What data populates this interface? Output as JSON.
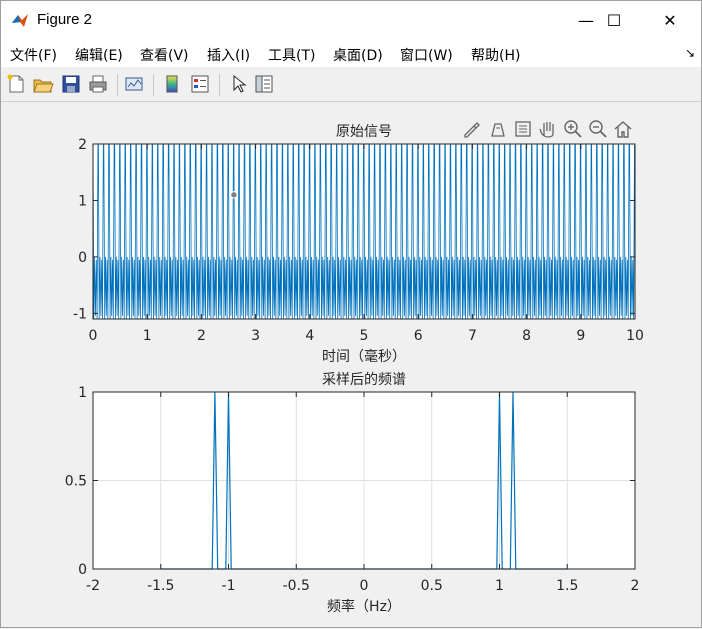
{
  "window": {
    "title": "Figure 2",
    "minimize": "—",
    "maximize": "☐",
    "close": "✕"
  },
  "menu": {
    "items": [
      "文件(F)",
      "编辑(E)",
      "查看(V)",
      "插入(I)",
      "工具(T)",
      "桌面(D)",
      "窗口(W)",
      "帮助(H)"
    ],
    "dock_arrow": "↘"
  },
  "toolbar": [
    "new-figure-icon",
    "open-file-icon",
    "save-icon",
    "print-icon",
    "link-plot-icon",
    "insert-colorbar-icon",
    "insert-legend-icon",
    "edit-plot-icon",
    "property-inspector-icon"
  ],
  "axes_toolbar": [
    "brush-icon",
    "data-tips-icon",
    "restore-view-icon",
    "pan-icon",
    "zoom-in-icon",
    "zoom-out-icon",
    "home-icon"
  ],
  "chart_data": [
    {
      "type": "line",
      "title": "原始信号",
      "xlabel": "时间（毫秒）",
      "ylabel": "",
      "xlim": [
        0,
        10
      ],
      "ylim": [
        -1.1,
        2
      ],
      "xticks": [
        "0",
        "1",
        "2",
        "3",
        "4",
        "5",
        "6",
        "7",
        "8",
        "9",
        "10"
      ],
      "yticks": [
        "2",
        "1",
        "0",
        "-1"
      ],
      "grid": false,
      "series": [
        {
          "description": "dense oscillating signal, peaks at 2, troughs near -1.1, periodic bursts",
          "cycles_per_unit": 10,
          "max": 2,
          "min": -1.1,
          "color": "#0072bd"
        }
      ],
      "marker_point": {
        "x": 2.6,
        "y": 1.1,
        "color": "#808080"
      }
    },
    {
      "type": "line",
      "title": "采样后的频谱",
      "xlabel": "频率（Hz）",
      "ylabel": "",
      "xlim": [
        -2,
        2
      ],
      "ylim": [
        0,
        1
      ],
      "xticks": [
        "-2",
        "-1.5",
        "-1",
        "-0.5",
        "0",
        "0.5",
        "1",
        "1.5",
        "2"
      ],
      "yticks": [
        "1",
        "0.5",
        "0"
      ],
      "grid": true,
      "series": [
        {
          "color": "#0072bd",
          "x": [
            -1.5,
            -1.12,
            -1.1,
            -1.08,
            -1.02,
            -1.0,
            -0.98,
            0,
            0.98,
            1.0,
            1.02,
            1.08,
            1.1,
            1.12,
            1.5
          ],
          "y": [
            0,
            0,
            1,
            0,
            0,
            1,
            0,
            0,
            0,
            1,
            0,
            0,
            1,
            0,
            0
          ]
        }
      ]
    }
  ]
}
